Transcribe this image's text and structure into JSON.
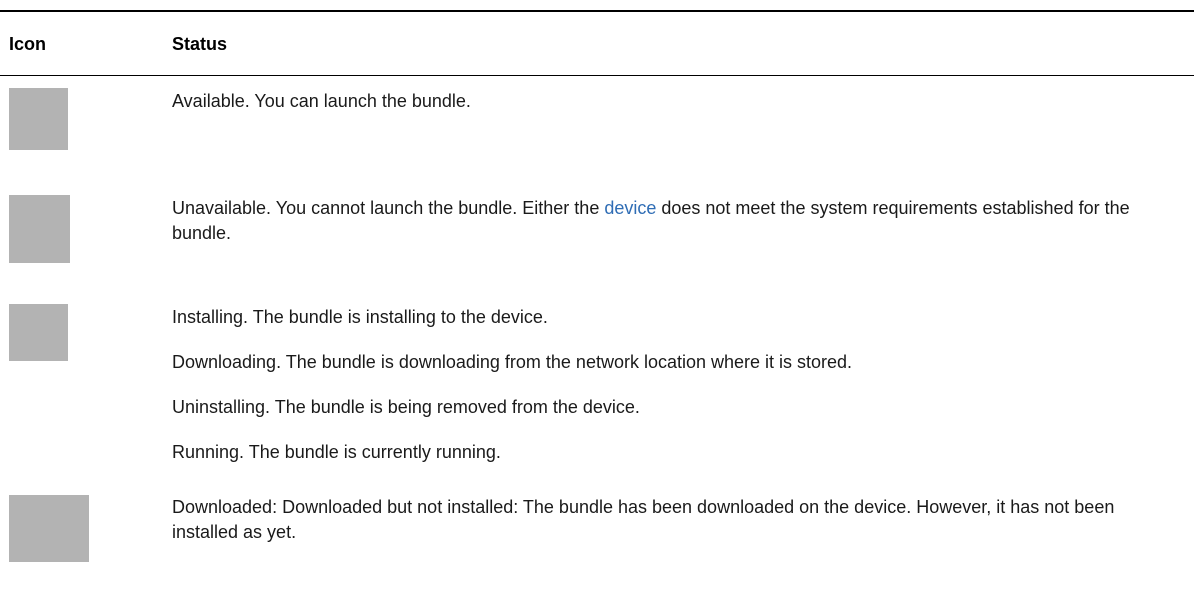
{
  "table": {
    "headers": {
      "icon": "Icon",
      "status": "Status"
    },
    "rows": [
      {
        "icon": "available-status-icon",
        "paragraphs": [
          "Available. You can launch the bundle."
        ]
      },
      {
        "icon": "unavailable-status-icon",
        "text_before_link": "Unavailable. You cannot launch the bundle. Either the ",
        "link_text": "device",
        "text_after_link": " does not meet the system requirements established for the bundle."
      },
      {
        "icon": "in-progress-status-icon",
        "paragraphs": [
          "Installing. The bundle is installing to the device.",
          "Downloading. The bundle is downloading from the network location where it is stored.",
          "Uninstalling. The bundle is being removed from the device.",
          "Running. The bundle is currently running."
        ]
      },
      {
        "icon": "downloaded-status-icon",
        "paragraphs": [
          "Downloaded: Downloaded but not installed: The bundle has been downloaded on the device. However, it has not been installed as yet."
        ]
      }
    ]
  },
  "colors": {
    "link": "#2f6db5",
    "icon_placeholder": "#b3b3b3",
    "rule": "#000000"
  }
}
